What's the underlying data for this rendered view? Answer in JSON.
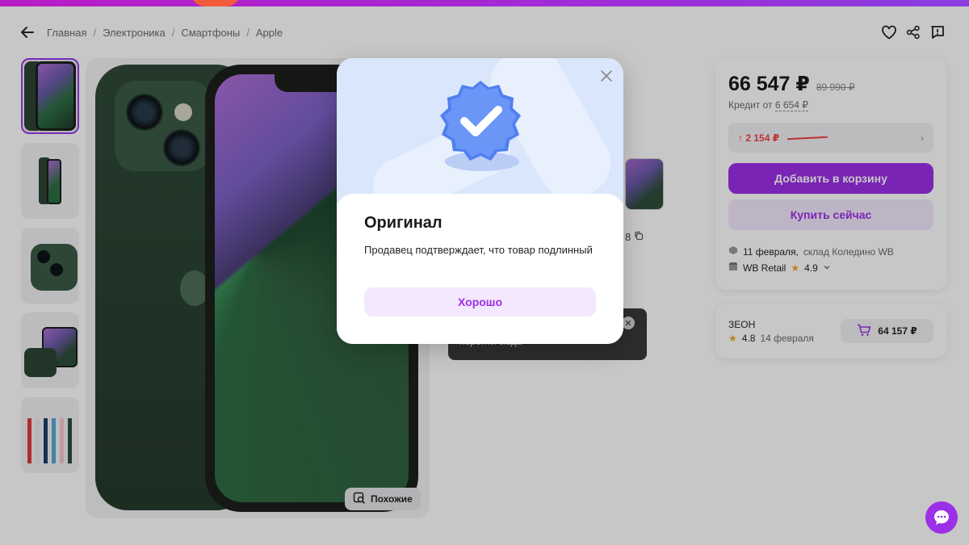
{
  "breadcrumb": [
    "Главная",
    "Электроника",
    "Смартфоны",
    "Apple"
  ],
  "similar_label": "Похожие",
  "mid": {
    "copy_text": "8",
    "toast_text": "перейти сюда"
  },
  "price_card": {
    "price": "66 547 ₽",
    "old_price": "89 990 ₽",
    "credit_label": "Кредит от",
    "credit_amount": "6 654 ₽",
    "price_change": "↑ 2 154 ₽",
    "add_to_cart": "Добавить в корзину",
    "buy_now": "Купить сейчас",
    "delivery_date": "11 февраля,",
    "delivery_warehouse": "склад Коледино WB",
    "seller_name": "WB Retail",
    "seller_rating": "4.9"
  },
  "offer_card": {
    "seller": "ЗЕОН",
    "rating": "4.8",
    "date": "14 февраля",
    "price": "64 157 ₽"
  },
  "modal": {
    "title": "Оригинал",
    "text": "Продавец подтверждает, что товар подлинный",
    "ok_label": "Хорошо"
  },
  "colors": {
    "accent": "#9c2fe8",
    "accent_light": "#f3e8fd",
    "price_up": "#f33f3f",
    "star": "#f5a623",
    "badge_blue": "#4f7ff0"
  },
  "icons": [
    "back-arrow-icon",
    "heart-icon",
    "share-icon",
    "report-icon",
    "copy-icon",
    "similar-search-icon",
    "cart-icon",
    "box-icon",
    "shop-icon",
    "star-icon",
    "chevron-right-icon",
    "chevron-down-icon",
    "close-icon",
    "verified-badge-icon",
    "chat-icon"
  ]
}
